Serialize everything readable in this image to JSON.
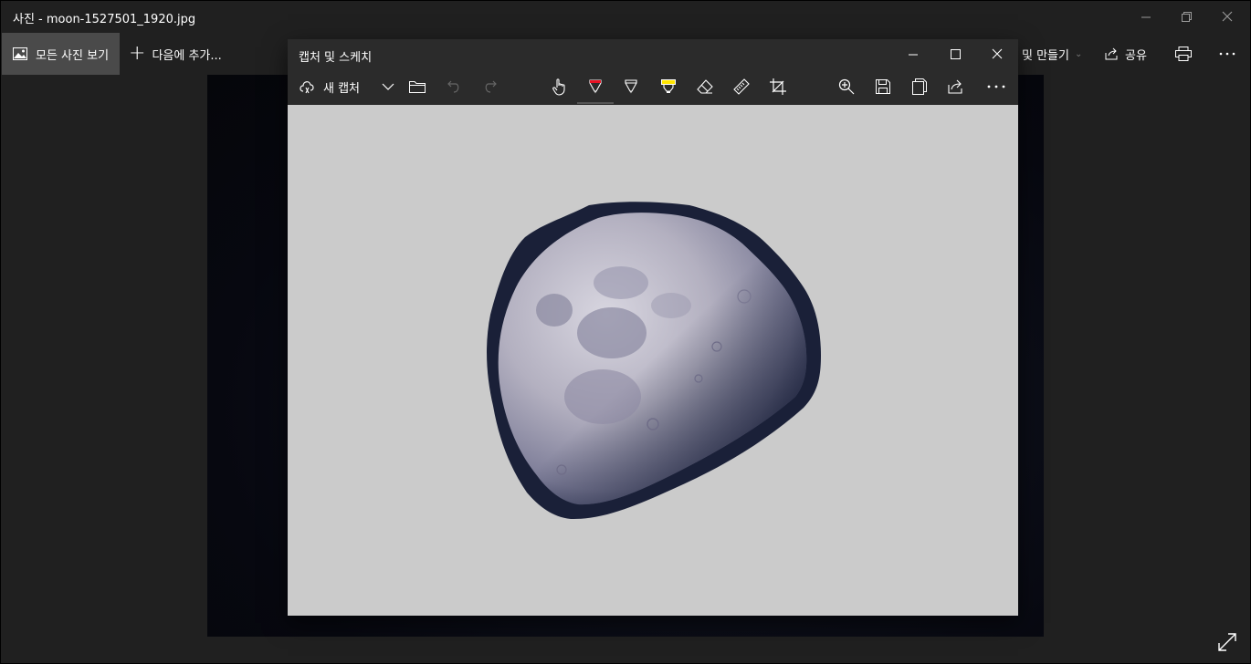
{
  "photos_app": {
    "title": "사진 - moon-1527501_1920.jpg",
    "window_controls": {
      "minimize": "minimize-icon",
      "restore": "restore-icon",
      "close": "close-icon"
    },
    "commands": {
      "all_photos": "모든 사진 보기",
      "add_to": "다음에 추가...",
      "create": "및 만들기",
      "share": "공유",
      "print_icon": "printer-icon",
      "more_icon": "more-icon"
    },
    "expand_icon": "expand-icon"
  },
  "snip_app": {
    "title": "캡처 및 스케치",
    "new_snip": "새 캡처",
    "toolbar_icons": [
      "new-snip-icon",
      "chevron-down-icon",
      "folder-icon",
      "undo-icon",
      "redo-icon",
      "touch-writing-icon",
      "ballpoint-pen-icon",
      "pencil-icon",
      "highlighter-icon",
      "eraser-icon",
      "ruler-icon",
      "crop-icon",
      "zoom-icon",
      "save-icon",
      "copy-icon",
      "share-icon",
      "more-icon"
    ],
    "active_tool": "ballpoint-pen",
    "colors": {
      "pen": "#e81123",
      "highlighter": "#ffe500",
      "canvas": "#cbcbcb",
      "moon_shadow": "#1a2038"
    }
  }
}
